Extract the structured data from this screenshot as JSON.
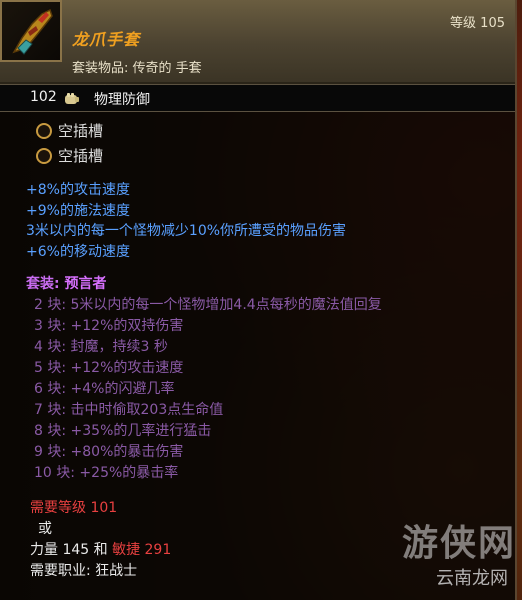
{
  "item": {
    "title": "龙爪手套",
    "type": "套装物品: 传奇的 手套",
    "level": "等级 105",
    "icon": "gauntlet-icon",
    "title_color": "#f0a020"
  },
  "defense": {
    "value": "102",
    "icon": "fist-icon",
    "label": "物理防御"
  },
  "sockets": [
    {
      "label": "空插槽"
    },
    {
      "label": "空插槽"
    }
  ],
  "magic_props": [
    "+8%的攻击速度",
    "+9%的施法速度",
    "3米以内的每一个怪物减少10%你所遭受的物品伤害",
    "+6%的移动速度"
  ],
  "set": {
    "prefix": "套装:",
    "name": "预言者",
    "bonuses": [
      "2 块: 5米以内的每一个怪物增加4.4点每秒的魔法值回复",
      "3 块: +12%的双持伤害",
      "4 块: 封魔，持续3 秒",
      "5 块: +12%的攻击速度",
      "6 块: +4%的闪避几率",
      "7 块: 击中时偷取203点生命值",
      "8 块: +35%的几率进行猛击",
      "9 块: +80%的暴击伤害",
      "10 块: +25%的暴击率"
    ]
  },
  "requirements": {
    "level": "需要等级 101",
    "or": "或",
    "str_prefix": "力量 145 和 ",
    "dex": "敏捷 291",
    "class": "需要职业: 狂战士"
  },
  "watermark": {
    "big": "游侠网",
    "small": "云南龙网"
  },
  "colors": {
    "magic": "#5aa0ff",
    "set": "#c86cf0",
    "set_bonus": "#8a5aa6",
    "requirement_unmet": "#e84040"
  }
}
